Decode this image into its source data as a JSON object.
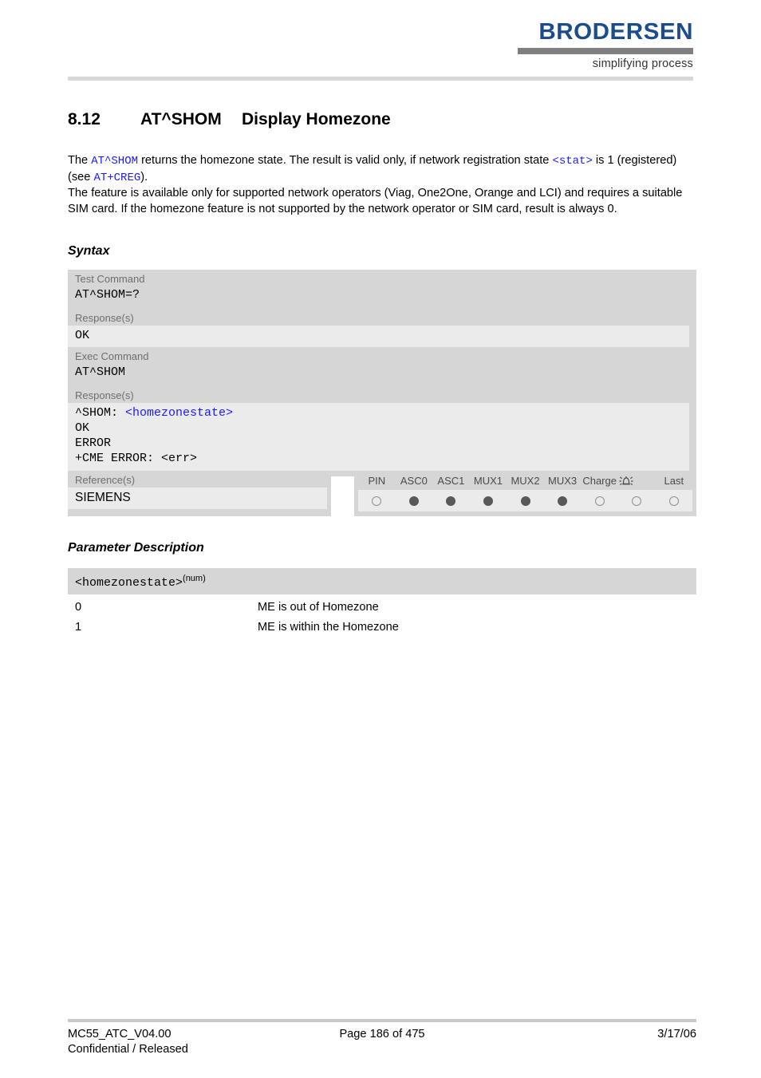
{
  "header": {
    "logo_word": "BRODERSEN",
    "logo_tagline": "simplifying process"
  },
  "title": {
    "number": "8.12",
    "command": "AT^SHOM",
    "name": "Display Homezone"
  },
  "intro": {
    "p1_a": "The ",
    "p1_cmd": "AT^SHOM",
    "p1_b": " returns the homezone state. The result is valid only, if network registration state ",
    "p1_param": "<stat>",
    "p1_c": " is 1 (registered) (see ",
    "p1_cmd2": "AT+CREG",
    "p1_d": ").",
    "p2": "The feature is available only for supported network operators (Viag, One2One, Orange and LCI) and requires a suitable SIM card. If the homezone feature is not supported by the network operator or SIM card, result is always 0."
  },
  "headings": {
    "syntax": "Syntax",
    "parameter_description": "Parameter Description"
  },
  "syntax": {
    "test": {
      "label": "Test Command",
      "command": "AT^SHOM=?",
      "response_label": "Response(s)",
      "responses": [
        "OK"
      ]
    },
    "exec": {
      "label": "Exec Command",
      "command": "AT^SHOM",
      "response_label": "Response(s)",
      "response_line1_prefix": "^SHOM: ",
      "response_line1_param": "<homezonestate>",
      "responses": [
        "OK",
        "ERROR",
        "+CME ERROR: <err>"
      ]
    }
  },
  "reference": {
    "label": "Reference(s)",
    "value": "SIEMENS"
  },
  "indicators": {
    "columns": [
      "PIN",
      "ASC0",
      "ASC1",
      "MUX1",
      "MUX2",
      "MUX3",
      "Charge",
      "alarm-icon",
      "Last"
    ],
    "states": [
      "off",
      "on",
      "on",
      "on",
      "on",
      "on",
      "off",
      "off",
      "off"
    ]
  },
  "parameters": {
    "name": "<homezonestate>",
    "type_superscript": "(num)",
    "rows": [
      {
        "key": "0",
        "desc": "ME is out of Homezone"
      },
      {
        "key": "1",
        "desc": "ME is within the Homezone"
      }
    ]
  },
  "footer": {
    "document": "MC55_ATC_V04.00",
    "classification": "Confidential / Released",
    "page": "Page 186 of 475",
    "date": "3/17/06"
  },
  "colors": {
    "link_blue": "#1a1aff",
    "logo_blue": "#1c4c8c",
    "table_header_gray": "#d6d6d6",
    "table_body_gray": "#ebebeb"
  }
}
